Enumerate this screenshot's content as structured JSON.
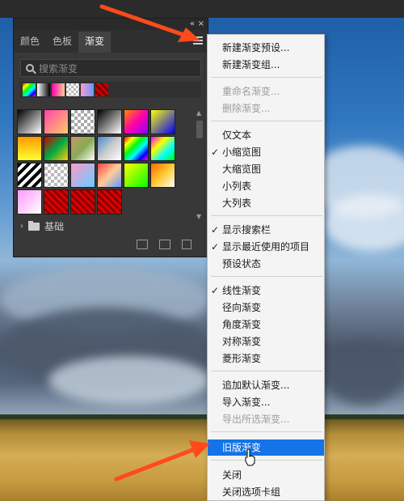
{
  "tabs": [
    {
      "label": "颜色"
    },
    {
      "label": "色板"
    },
    {
      "label": "渐变"
    }
  ],
  "panel": {
    "search_placeholder": "搜索渐变",
    "folder_label": "基础",
    "titlebar": {
      "collapse": "«",
      "close": "×"
    }
  },
  "menu": {
    "items": [
      {
        "label": "新建渐变预设...",
        "disabled": false
      },
      {
        "label": "新建渐变组...",
        "disabled": false
      },
      {
        "label": "重命名渐变...",
        "disabled": true
      },
      {
        "label": "删除渐变...",
        "disabled": true
      },
      {
        "label": "仅文本",
        "disabled": false
      },
      {
        "label": "小缩览图",
        "checked": true
      },
      {
        "label": "大缩览图"
      },
      {
        "label": "小列表"
      },
      {
        "label": "大列表"
      },
      {
        "label": "显示搜索栏",
        "checked": true
      },
      {
        "label": "显示最近使用的项目",
        "checked": true
      },
      {
        "label": "预设状态"
      },
      {
        "label": "线性渐变",
        "checked": true
      },
      {
        "label": "径向渐变"
      },
      {
        "label": "角度渐变"
      },
      {
        "label": "对称渐变"
      },
      {
        "label": "菱形渐变"
      },
      {
        "label": "追加默认渐变..."
      },
      {
        "label": "导入渐变..."
      },
      {
        "label": "导出所选渐变...",
        "disabled": true
      },
      {
        "label": "旧版渐变",
        "highlighted": true
      },
      {
        "label": "关闭"
      },
      {
        "label": "关闭选项卡组"
      }
    ]
  },
  "colors": {
    "accent": "#1473e6",
    "arrow": "#ff4a1c",
    "panel_bg": "#383838"
  }
}
